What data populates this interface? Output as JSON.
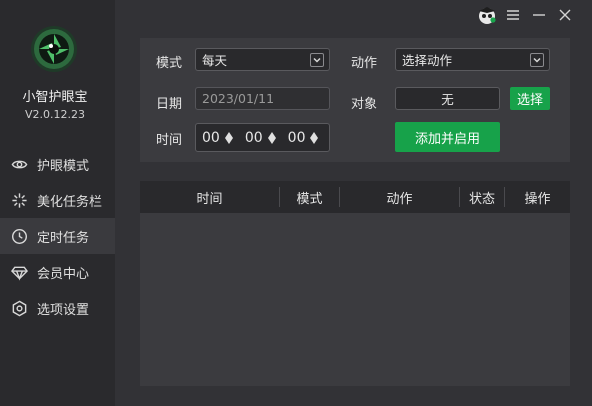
{
  "app": {
    "name": "小智护眼宝",
    "version": "V2.0.12.23"
  },
  "sidebar": {
    "items": [
      {
        "label": "护眼模式",
        "icon": "eye-icon",
        "active": false
      },
      {
        "label": "美化任务栏",
        "icon": "sparkle-icon",
        "active": false
      },
      {
        "label": "定时任务",
        "icon": "clock-icon",
        "active": true
      },
      {
        "label": "会员中心",
        "icon": "diamond-icon",
        "active": false
      },
      {
        "label": "选项设置",
        "icon": "gear-icon",
        "active": false
      }
    ]
  },
  "titlebar": {
    "icons": [
      "mascot-icon",
      "menu-icon",
      "minimize-icon",
      "close-icon"
    ]
  },
  "form": {
    "mode_label": "模式",
    "mode_value": "每天",
    "action_label": "动作",
    "action_value": "选择动作",
    "date_label": "日期",
    "date_value": "2023/01/11",
    "target_label": "对象",
    "target_value": "无",
    "select_button": "选择",
    "time_label": "时间",
    "time_hour": "00",
    "time_minute": "00",
    "time_second": "00",
    "add_button": "添加并启用"
  },
  "table": {
    "columns": [
      "时间",
      "模式",
      "动作",
      "状态",
      "操作"
    ],
    "rows": []
  },
  "colors": {
    "accent_green": "#17a24a",
    "sidebar_bg": "#2a2a2d",
    "main_bg": "#323236",
    "panel_bg": "#3b3b3f"
  }
}
